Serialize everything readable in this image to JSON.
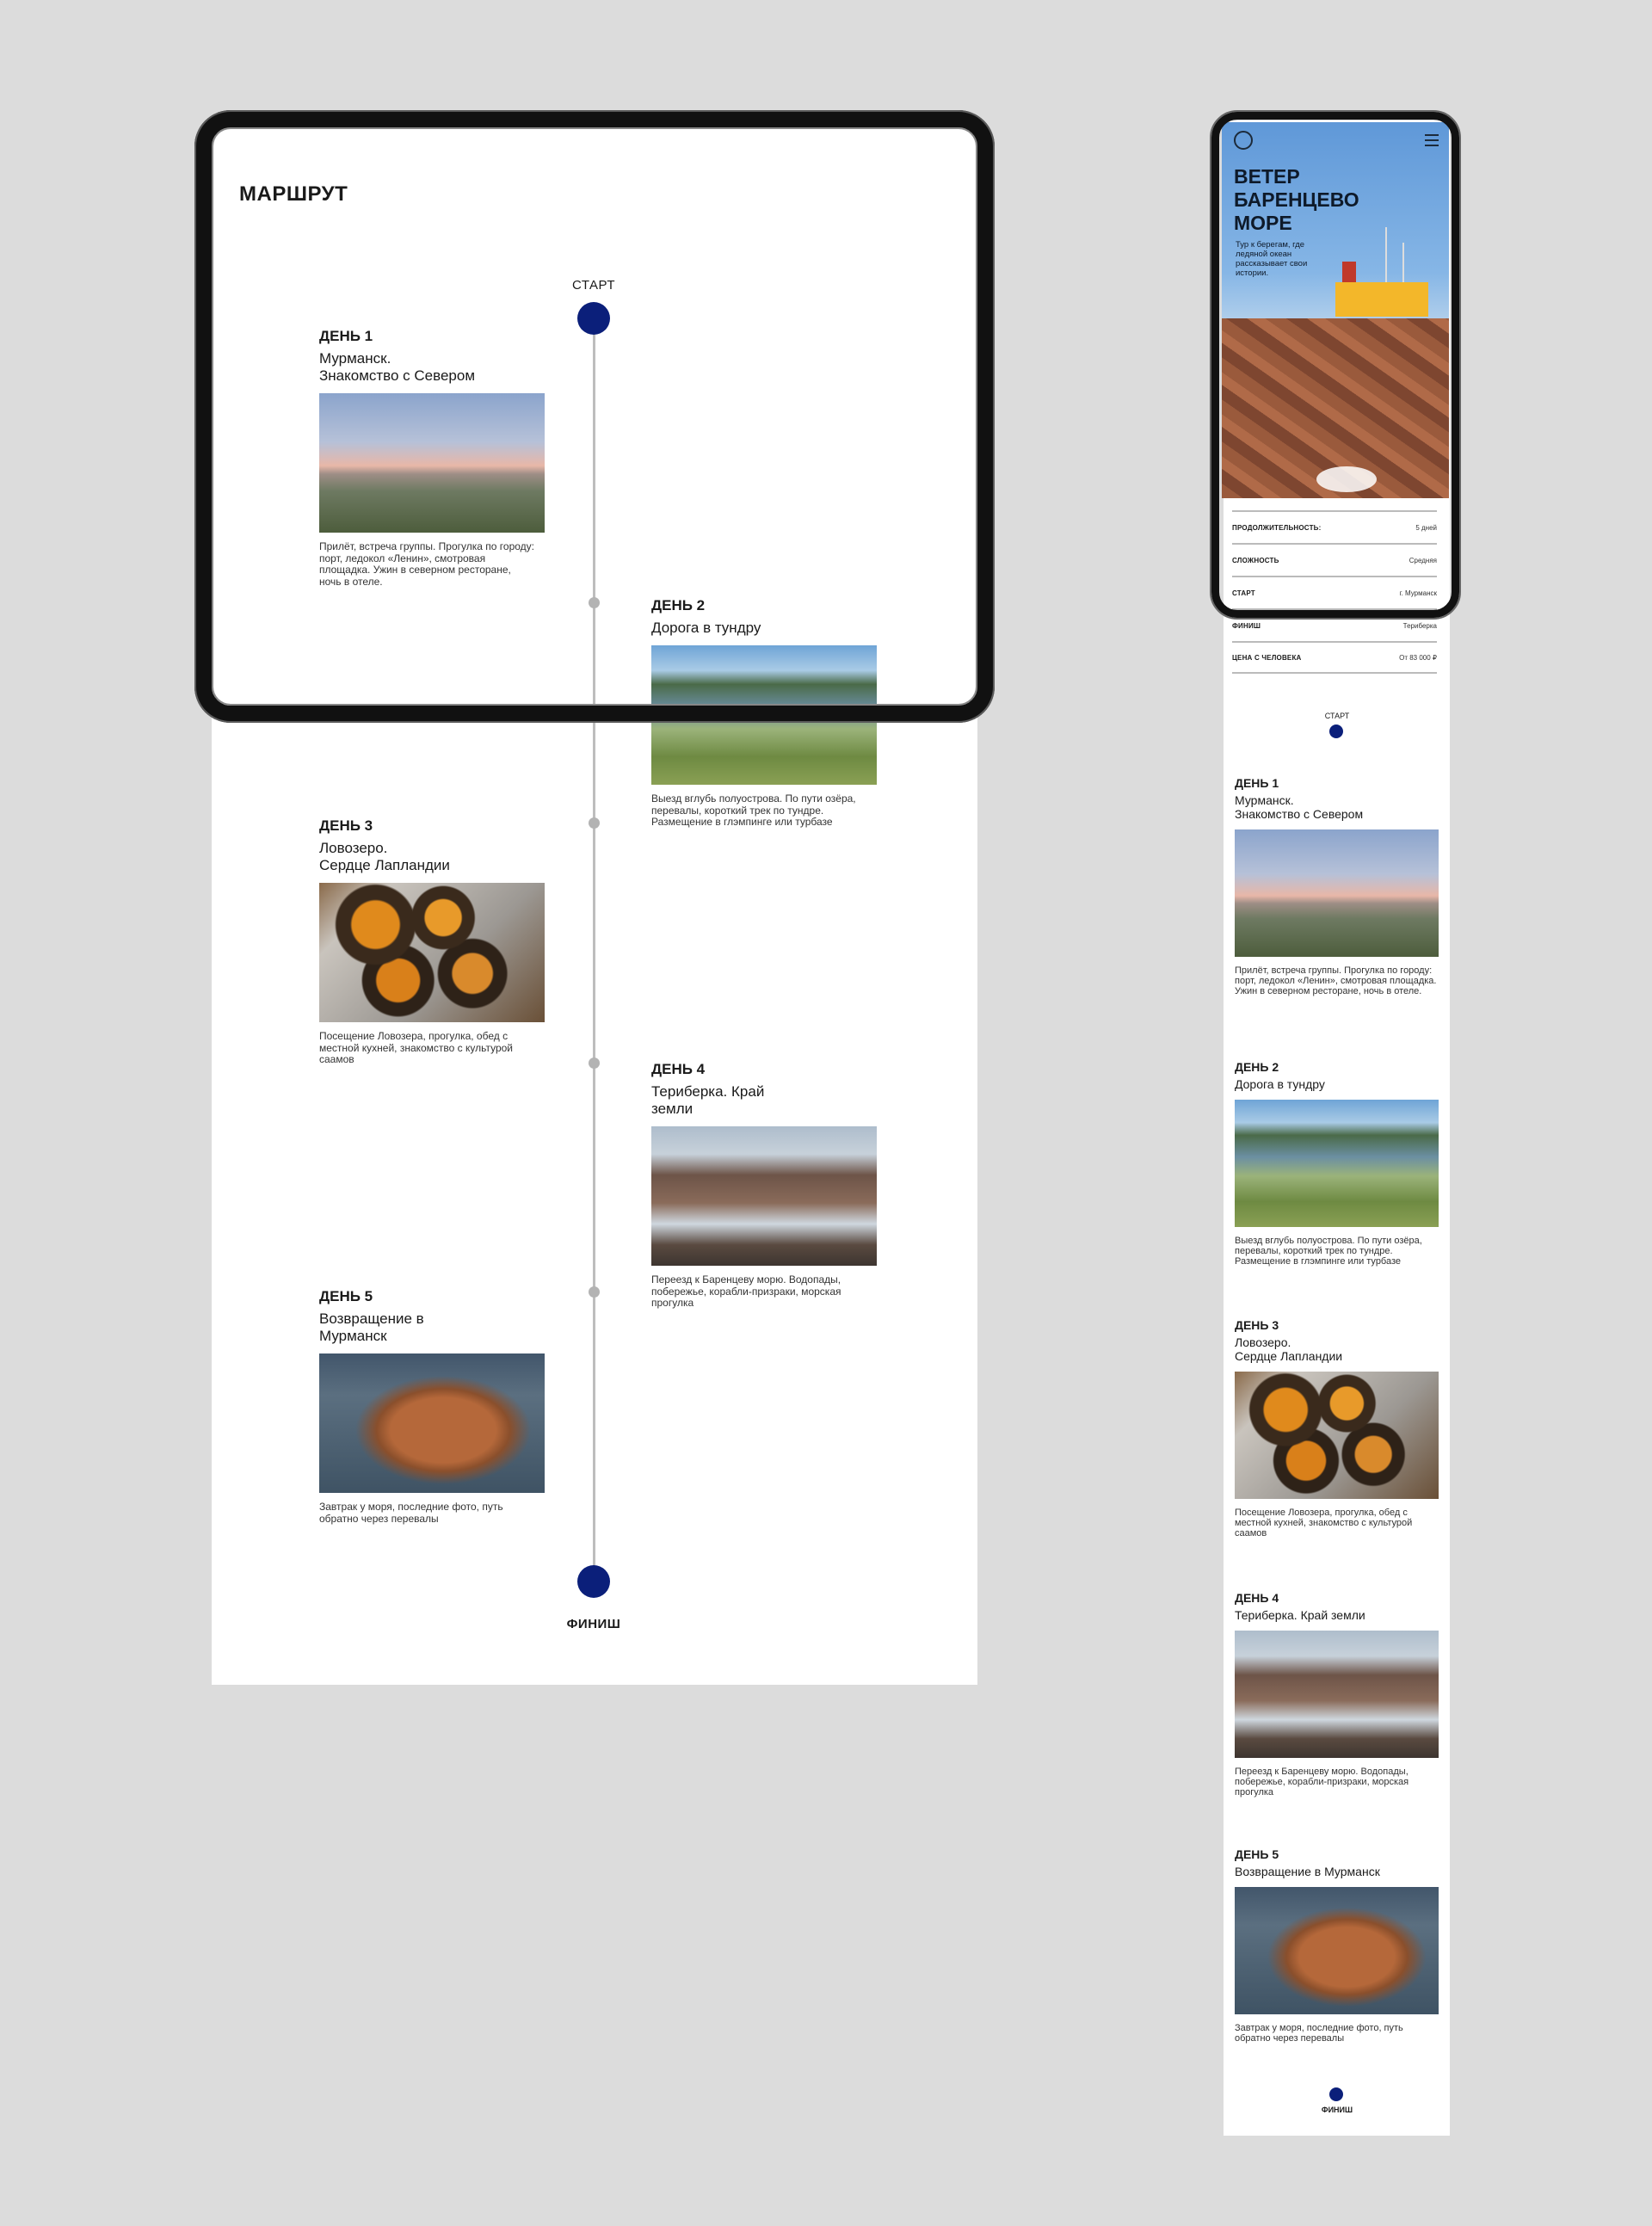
{
  "tablet": {
    "section_title": "МАРШРУТ",
    "start_label": "СТАРТ",
    "finish_label": "ФИНИШ",
    "days": [
      {
        "num": "ДЕНЬ 1",
        "title": "Мурманск.\nЗнакомство с Севером",
        "desc": "Прилёт, встреча группы. Прогулка по городу: порт, ледокол «Ленин», смотровая площадка. Ужин в северном ресторане, ночь в отеле."
      },
      {
        "num": "ДЕНЬ 2",
        "title": "Дорога в тундру",
        "desc": "Выезд вглубь полуострова. По пути озёра, перевалы, короткий трек по тундре. Размещение в глэмпинге или турбазе"
      },
      {
        "num": "ДЕНЬ 3",
        "title": "Ловозеро.\nСердце Лапландии",
        "desc": "Посещение Ловозера, прогулка, обед с местной кухней, знакомство с культурой саамов"
      },
      {
        "num": "ДЕНЬ 4",
        "title": "Териберка. Край\nземли",
        "desc": "Переезд к Баренцеву морю. Водопады, побережье, корабли-призраки, морская прогулка"
      },
      {
        "num": "ДЕНЬ 5",
        "title": "Возвращение в\nМурманск",
        "desc": "Завтрак у моря, последние фото, путь обратно через перевалы"
      }
    ]
  },
  "phone": {
    "hero_title": "ВЕТЕР\nБАРЕНЦЕВО\nМОРЕ",
    "hero_subtitle": "Тур к берегам, где ледяной океан рассказывает свои истории.",
    "info": [
      {
        "key": "ПРОДОЛЖИТЕЛЬНОСТЬ:",
        "value": "5 дней"
      },
      {
        "key": "СЛОЖНОСТЬ",
        "value": "Средняя"
      },
      {
        "key": "СТАРТ",
        "value": "г. Мурманск"
      },
      {
        "key": "ФИНИШ",
        "value": "Териберка"
      },
      {
        "key": "ЦЕНА С ЧЕЛОВЕКА",
        "value": "От 83 000 ₽"
      }
    ],
    "start_label": "СТАРТ",
    "finish_label": "ФИНИШ",
    "days": [
      {
        "num": "ДЕНЬ 1",
        "title": "Мурманск.\nЗнакомство с Севером",
        "desc": "Прилёт, встреча группы. Прогулка по городу: порт, ледокол «Ленин», смотровая площадка. Ужин в северном ресторане, ночь в отеле."
      },
      {
        "num": "ДЕНЬ 2",
        "title": "Дорога в тундру",
        "desc": "Выезд вглубь полуострова. По пути озёра, перевалы, короткий трек по тундре. Размещение в глэмпинге или турбазе"
      },
      {
        "num": "ДЕНЬ 3",
        "title": "Ловозеро.\nСердце Лапландии",
        "desc": "Посещение Ловозера, прогулка, обед с местной кухней, знакомство с культурой саамов"
      },
      {
        "num": "ДЕНЬ 4",
        "title": "Териберка. Край земли",
        "desc": "Переезд к Баренцеву морю. Водопады, побережье, корабли-призраки, морская прогулка"
      },
      {
        "num": "ДЕНЬ 5",
        "title": "Возвращение в Мурманск",
        "desc": "Завтрак у моря, последние фото, путь обратно через перевалы"
      }
    ]
  },
  "colors": {
    "accent_dot": "#0b1f7a",
    "background": "#dcdcdc"
  }
}
